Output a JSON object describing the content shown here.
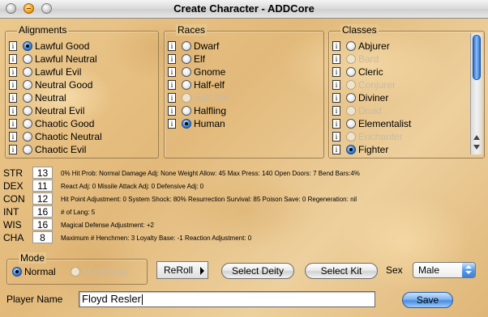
{
  "window": {
    "title": "Create Character - ADDCore"
  },
  "alignments": {
    "title": "Alignments",
    "info_label": "i",
    "items": [
      {
        "label": "Lawful Good",
        "selected": true,
        "enabled": true
      },
      {
        "label": "Lawful Neutral",
        "selected": false,
        "enabled": true
      },
      {
        "label": "Lawful Evil",
        "selected": false,
        "enabled": true
      },
      {
        "label": "Neutral Good",
        "selected": false,
        "enabled": true
      },
      {
        "label": "Neutral",
        "selected": false,
        "enabled": true
      },
      {
        "label": "Neutral Evil",
        "selected": false,
        "enabled": true
      },
      {
        "label": "Chaotic Good",
        "selected": false,
        "enabled": true
      },
      {
        "label": "Chaotic Neutral",
        "selected": false,
        "enabled": true
      },
      {
        "label": "Chaotic Evil",
        "selected": false,
        "enabled": true
      }
    ]
  },
  "races": {
    "title": "Races",
    "info_label": "i",
    "items": [
      {
        "label": "Dwarf",
        "selected": false,
        "enabled": true
      },
      {
        "label": "Elf",
        "selected": false,
        "enabled": true
      },
      {
        "label": "Gnome",
        "selected": false,
        "enabled": true
      },
      {
        "label": "Half-elf",
        "selected": false,
        "enabled": true
      },
      {
        "label": "Half-Orc",
        "selected": false,
        "enabled": false
      },
      {
        "label": "Halfling",
        "selected": false,
        "enabled": true
      },
      {
        "label": "Human",
        "selected": true,
        "enabled": true
      }
    ]
  },
  "classes": {
    "title": "Classes",
    "info_label": "i",
    "items": [
      {
        "label": "Abjurer",
        "selected": false,
        "enabled": true
      },
      {
        "label": "Bard",
        "selected": false,
        "enabled": false
      },
      {
        "label": "Cleric",
        "selected": false,
        "enabled": true
      },
      {
        "label": "Conjurer",
        "selected": false,
        "enabled": false
      },
      {
        "label": "Diviner",
        "selected": false,
        "enabled": true
      },
      {
        "label": "Druid",
        "selected": false,
        "enabled": false
      },
      {
        "label": "Elementalist",
        "selected": false,
        "enabled": true
      },
      {
        "label": "Enchanter",
        "selected": false,
        "enabled": false
      },
      {
        "label": "Fighter",
        "selected": true,
        "enabled": true
      }
    ]
  },
  "stats": [
    {
      "name": "STR",
      "value": "13",
      "desc": "0% Hit Prob: Normal  Damage Adj: None  Weight Allow: 45  Max Press: 140  Open Doors: 7 Bend Bars:4%"
    },
    {
      "name": "DEX",
      "value": "11",
      "desc": "React Adj: 0  Missile Attack Adj: 0  Defensive Adj: 0"
    },
    {
      "name": "CON",
      "value": "12",
      "desc": "Hit Point Adjustment: 0  System Shock: 80%  Resurrection Survival: 85  Poison Save: 0  Regeneration: nil"
    },
    {
      "name": "INT",
      "value": "16",
      "desc": "# of Lang: 5"
    },
    {
      "name": "WIS",
      "value": "16",
      "desc": "Magical Defense Adjustment: +2"
    },
    {
      "name": "CHA",
      "value": "8",
      "desc": "Maximum # Henchmen: 3  Loyalty Base: -1  Reaction Adjustment: 0"
    }
  ],
  "mode": {
    "title": "Mode",
    "options": [
      {
        "label": "Normal",
        "selected": true,
        "enabled": true
      },
      {
        "label": "MultiClass",
        "selected": false,
        "enabled": false
      }
    ]
  },
  "buttons": {
    "reroll": "ReRoll",
    "select_deity": "Select Deity",
    "select_kit": "Select Kit",
    "save": "Save"
  },
  "sex": {
    "label": "Sex",
    "value": "Male"
  },
  "player": {
    "label": "Player Name",
    "value": "Floyd Resler"
  },
  "colors": {
    "accent": "#3f86d8",
    "parchment": "#e8c78f"
  }
}
